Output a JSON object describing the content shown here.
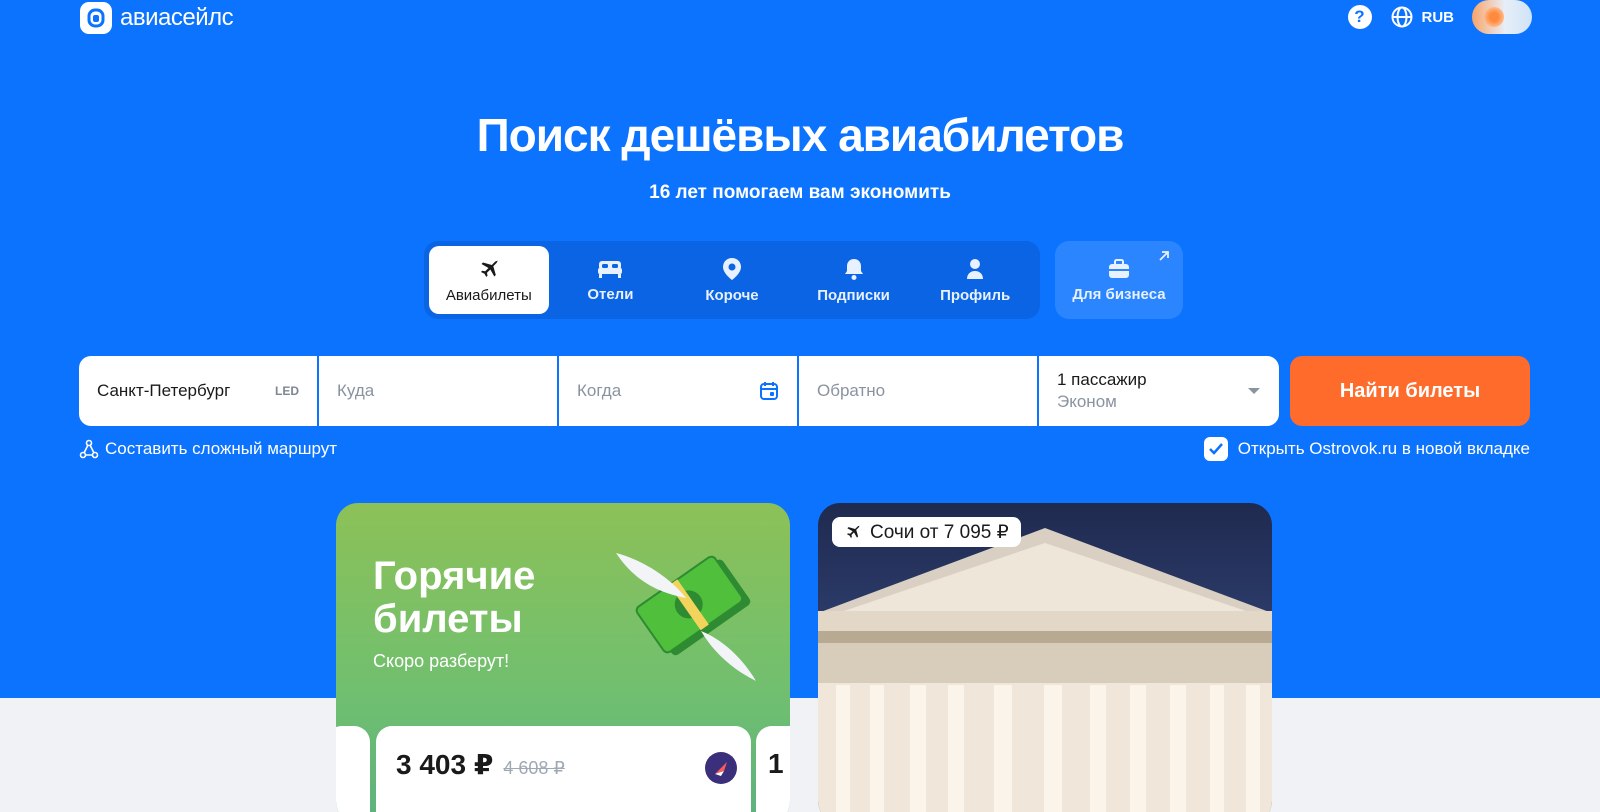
{
  "header": {
    "logo_text": "авиасейлс",
    "help_label": "?",
    "currency": "RUB"
  },
  "hero": {
    "title": "Поиск дешёвых авиабилетов",
    "subtitle": "16 лет помогаем вам экономить"
  },
  "tabs": [
    {
      "label": "Авиабилеты",
      "icon": "plane-icon",
      "active": true
    },
    {
      "label": "Отели",
      "icon": "bed-icon",
      "active": false
    },
    {
      "label": "Короче",
      "icon": "location-pin-icon",
      "active": false
    },
    {
      "label": "Подписки",
      "icon": "bell-icon",
      "active": false
    },
    {
      "label": "Профиль",
      "icon": "person-icon",
      "active": false
    }
  ],
  "business_tab": {
    "label": "Для бизнеса",
    "icon": "briefcase-icon"
  },
  "search": {
    "origin_value": "Санкт-Петербург",
    "origin_code": "LED",
    "destination_placeholder": "Куда",
    "date_placeholder": "Когда",
    "return_placeholder": "Обратно",
    "passengers": "1 пассажир",
    "cabin_class": "Эконом",
    "submit_label": "Найти билеты"
  },
  "links": {
    "complex_route": "Составить сложный маршрут",
    "ostrovok_label": "Открыть Ostrovok.ru в новой вкладке",
    "ostrovok_checked": true
  },
  "hot_card": {
    "title_line1": "Горячие",
    "title_line2": "билеты",
    "subtitle": "Скоро разберут!",
    "price": "3 403 ₽",
    "old_price": "4 608 ₽",
    "next_price_digit": "1"
  },
  "sochi_card": {
    "badge": "Сочи от 7 095 ₽"
  },
  "colors": {
    "brand_blue": "#0c73fe",
    "cta_orange": "#ff6b2b",
    "hot_green": "#7ec165"
  }
}
